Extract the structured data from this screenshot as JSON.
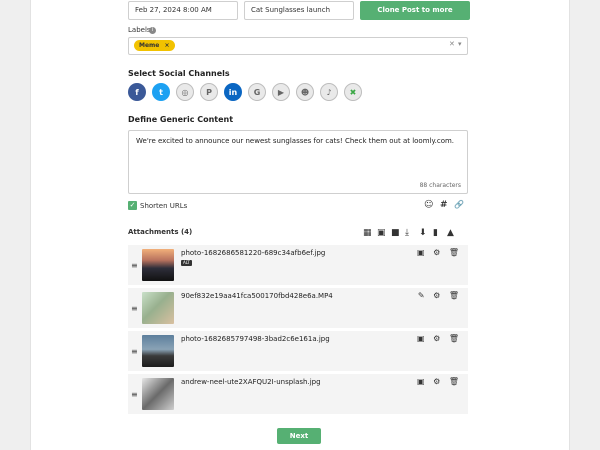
{
  "form": {
    "date_value": "Feb 27, 2024 8:00 AM",
    "title_value": "Cat Sunglasses launch",
    "clone_label": "Clone Post to more Calendars"
  },
  "labels": {
    "title": "Labels",
    "chip": "Meme",
    "chip_remove": "×",
    "info_icon": "i",
    "clear_icon": "✕",
    "caret_icon": "▾"
  },
  "channels": {
    "title": "Select Social Channels",
    "items": [
      {
        "icon": "facebook-icon",
        "glyph": "f",
        "active": true,
        "color": "#3b5998"
      },
      {
        "icon": "twitter-icon",
        "glyph": "t",
        "active": true,
        "color": "#1da1f2"
      },
      {
        "icon": "instagram-icon",
        "glyph": "◎",
        "active": false
      },
      {
        "icon": "pinterest-icon",
        "glyph": "P",
        "active": false
      },
      {
        "icon": "linkedin-icon",
        "glyph": "in",
        "active": true,
        "color": "#0a66c2"
      },
      {
        "icon": "google-icon",
        "glyph": "G",
        "active": false
      },
      {
        "icon": "youtube-icon",
        "glyph": "▶",
        "active": false
      },
      {
        "icon": "snapchat-icon",
        "glyph": "☻",
        "active": false
      },
      {
        "icon": "tiktok-icon",
        "glyph": "♪",
        "active": false
      },
      {
        "icon": "custom-channel-icon",
        "glyph": "✖",
        "active": false,
        "color": "#3aa845"
      }
    ]
  },
  "content": {
    "title": "Define Generic Content",
    "text": "We're excited to announce our newest sunglasses for cats! Check them out at loomly.com.",
    "char_count": "88 characters"
  },
  "options": {
    "shorten_urls": "Shorten URLs",
    "check_glyph": "✓",
    "emoji_glyph": "☺",
    "hashtag_glyph": "#",
    "link_glyph": "🔗"
  },
  "attachments": {
    "title": "Attachments (4)",
    "toolbar_glyphs": [
      "▦",
      "▣",
      "■",
      "⤓",
      "⬇",
      "▮",
      "▲"
    ],
    "items": [
      {
        "name": "photo-1682686581220-689c34afb6ef.jpg",
        "alt": "ALT",
        "actions": "▣ ⚙ 🗑"
      },
      {
        "name": "90ef832e19aa41fca500170fbd428e6a.MP4",
        "alt": "",
        "actions": "✎ ⚙ 🗑"
      },
      {
        "name": "photo-1682685797498-3bad2c6e161a.jpg",
        "alt": "",
        "actions": "▣ ⚙ 🗑"
      },
      {
        "name": "andrew-neel-ute2XAFQU2I-unsplash.jpg",
        "alt": "",
        "actions": "▣ ⚙ 🗑"
      }
    ]
  },
  "footer": {
    "next_label": "Next"
  },
  "drag_glyph": "≡"
}
